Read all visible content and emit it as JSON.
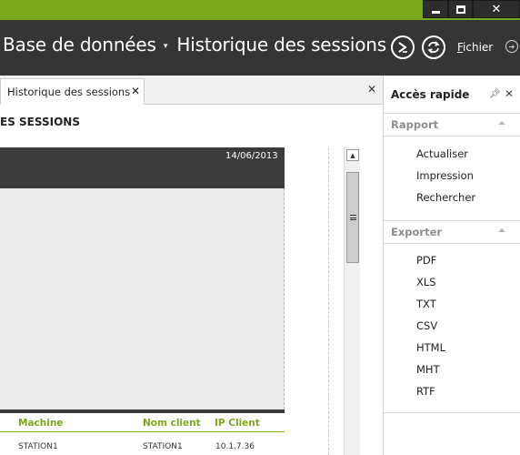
{
  "titlebar": {
    "breadcrumb_db": "Base de données",
    "breadcrumb_sep": "▾",
    "page_title": "Historique des sessions",
    "fichier_prefix": "F",
    "fichier_rest": "ichier"
  },
  "tabs": [
    {
      "label": "Historique des sessions",
      "close": "✕"
    }
  ],
  "doc": {
    "panel_close": "✕",
    "section_title": "ES SESSIONS",
    "report_date": "14/06/2013",
    "columns": [
      "Machine",
      "Nom client",
      "IP Client"
    ],
    "row": [
      "STATION1",
      "STATION1",
      "10.1.7.36"
    ]
  },
  "quick_access": {
    "title": "Accès rapide",
    "close": "✕",
    "groups": [
      {
        "label": "Rapport",
        "items": [
          "Actualiser",
          "Impression",
          "Rechercher"
        ]
      },
      {
        "label": "Exporter",
        "items": [
          "PDF",
          "XLS",
          "TXT",
          "CSV",
          "HTML",
          "MHT",
          "RTF"
        ]
      }
    ]
  },
  "colors": {
    "accent_green": "#7aa71b",
    "titlebar_dark": "#333537"
  }
}
